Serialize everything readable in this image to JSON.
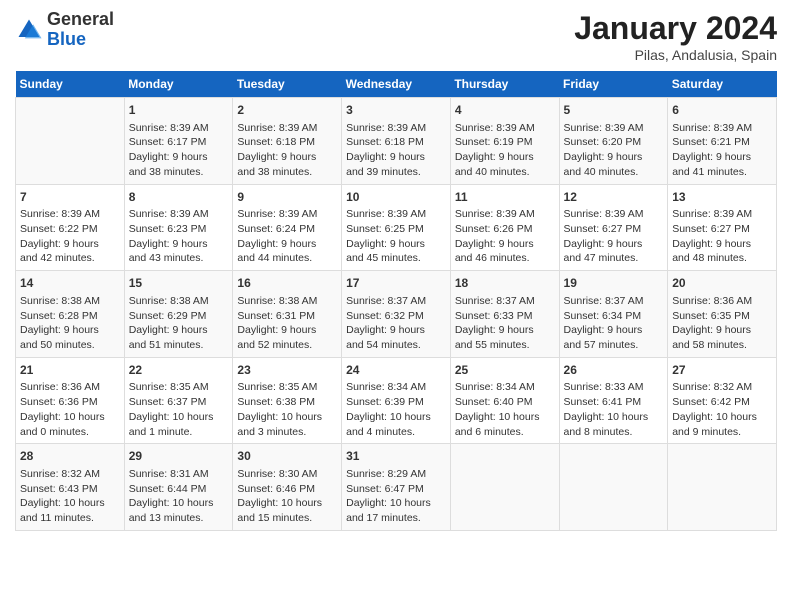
{
  "header": {
    "logo_general": "General",
    "logo_blue": "Blue",
    "title": "January 2024",
    "subtitle": "Pilas, Andalusia, Spain"
  },
  "columns": [
    "Sunday",
    "Monday",
    "Tuesday",
    "Wednesday",
    "Thursday",
    "Friday",
    "Saturday"
  ],
  "rows": [
    [
      {
        "day": "",
        "info": ""
      },
      {
        "day": "1",
        "info": "Sunrise: 8:39 AM\nSunset: 6:17 PM\nDaylight: 9 hours\nand 38 minutes."
      },
      {
        "day": "2",
        "info": "Sunrise: 8:39 AM\nSunset: 6:18 PM\nDaylight: 9 hours\nand 38 minutes."
      },
      {
        "day": "3",
        "info": "Sunrise: 8:39 AM\nSunset: 6:18 PM\nDaylight: 9 hours\nand 39 minutes."
      },
      {
        "day": "4",
        "info": "Sunrise: 8:39 AM\nSunset: 6:19 PM\nDaylight: 9 hours\nand 40 minutes."
      },
      {
        "day": "5",
        "info": "Sunrise: 8:39 AM\nSunset: 6:20 PM\nDaylight: 9 hours\nand 40 minutes."
      },
      {
        "day": "6",
        "info": "Sunrise: 8:39 AM\nSunset: 6:21 PM\nDaylight: 9 hours\nand 41 minutes."
      }
    ],
    [
      {
        "day": "7",
        "info": "Sunrise: 8:39 AM\nSunset: 6:22 PM\nDaylight: 9 hours\nand 42 minutes."
      },
      {
        "day": "8",
        "info": "Sunrise: 8:39 AM\nSunset: 6:23 PM\nDaylight: 9 hours\nand 43 minutes."
      },
      {
        "day": "9",
        "info": "Sunrise: 8:39 AM\nSunset: 6:24 PM\nDaylight: 9 hours\nand 44 minutes."
      },
      {
        "day": "10",
        "info": "Sunrise: 8:39 AM\nSunset: 6:25 PM\nDaylight: 9 hours\nand 45 minutes."
      },
      {
        "day": "11",
        "info": "Sunrise: 8:39 AM\nSunset: 6:26 PM\nDaylight: 9 hours\nand 46 minutes."
      },
      {
        "day": "12",
        "info": "Sunrise: 8:39 AM\nSunset: 6:27 PM\nDaylight: 9 hours\nand 47 minutes."
      },
      {
        "day": "13",
        "info": "Sunrise: 8:39 AM\nSunset: 6:27 PM\nDaylight: 9 hours\nand 48 minutes."
      }
    ],
    [
      {
        "day": "14",
        "info": "Sunrise: 8:38 AM\nSunset: 6:28 PM\nDaylight: 9 hours\nand 50 minutes."
      },
      {
        "day": "15",
        "info": "Sunrise: 8:38 AM\nSunset: 6:29 PM\nDaylight: 9 hours\nand 51 minutes."
      },
      {
        "day": "16",
        "info": "Sunrise: 8:38 AM\nSunset: 6:31 PM\nDaylight: 9 hours\nand 52 minutes."
      },
      {
        "day": "17",
        "info": "Sunrise: 8:37 AM\nSunset: 6:32 PM\nDaylight: 9 hours\nand 54 minutes."
      },
      {
        "day": "18",
        "info": "Sunrise: 8:37 AM\nSunset: 6:33 PM\nDaylight: 9 hours\nand 55 minutes."
      },
      {
        "day": "19",
        "info": "Sunrise: 8:37 AM\nSunset: 6:34 PM\nDaylight: 9 hours\nand 57 minutes."
      },
      {
        "day": "20",
        "info": "Sunrise: 8:36 AM\nSunset: 6:35 PM\nDaylight: 9 hours\nand 58 minutes."
      }
    ],
    [
      {
        "day": "21",
        "info": "Sunrise: 8:36 AM\nSunset: 6:36 PM\nDaylight: 10 hours\nand 0 minutes."
      },
      {
        "day": "22",
        "info": "Sunrise: 8:35 AM\nSunset: 6:37 PM\nDaylight: 10 hours\nand 1 minute."
      },
      {
        "day": "23",
        "info": "Sunrise: 8:35 AM\nSunset: 6:38 PM\nDaylight: 10 hours\nand 3 minutes."
      },
      {
        "day": "24",
        "info": "Sunrise: 8:34 AM\nSunset: 6:39 PM\nDaylight: 10 hours\nand 4 minutes."
      },
      {
        "day": "25",
        "info": "Sunrise: 8:34 AM\nSunset: 6:40 PM\nDaylight: 10 hours\nand 6 minutes."
      },
      {
        "day": "26",
        "info": "Sunrise: 8:33 AM\nSunset: 6:41 PM\nDaylight: 10 hours\nand 8 minutes."
      },
      {
        "day": "27",
        "info": "Sunrise: 8:32 AM\nSunset: 6:42 PM\nDaylight: 10 hours\nand 9 minutes."
      }
    ],
    [
      {
        "day": "28",
        "info": "Sunrise: 8:32 AM\nSunset: 6:43 PM\nDaylight: 10 hours\nand 11 minutes."
      },
      {
        "day": "29",
        "info": "Sunrise: 8:31 AM\nSunset: 6:44 PM\nDaylight: 10 hours\nand 13 minutes."
      },
      {
        "day": "30",
        "info": "Sunrise: 8:30 AM\nSunset: 6:46 PM\nDaylight: 10 hours\nand 15 minutes."
      },
      {
        "day": "31",
        "info": "Sunrise: 8:29 AM\nSunset: 6:47 PM\nDaylight: 10 hours\nand 17 minutes."
      },
      {
        "day": "",
        "info": ""
      },
      {
        "day": "",
        "info": ""
      },
      {
        "day": "",
        "info": ""
      }
    ]
  ]
}
